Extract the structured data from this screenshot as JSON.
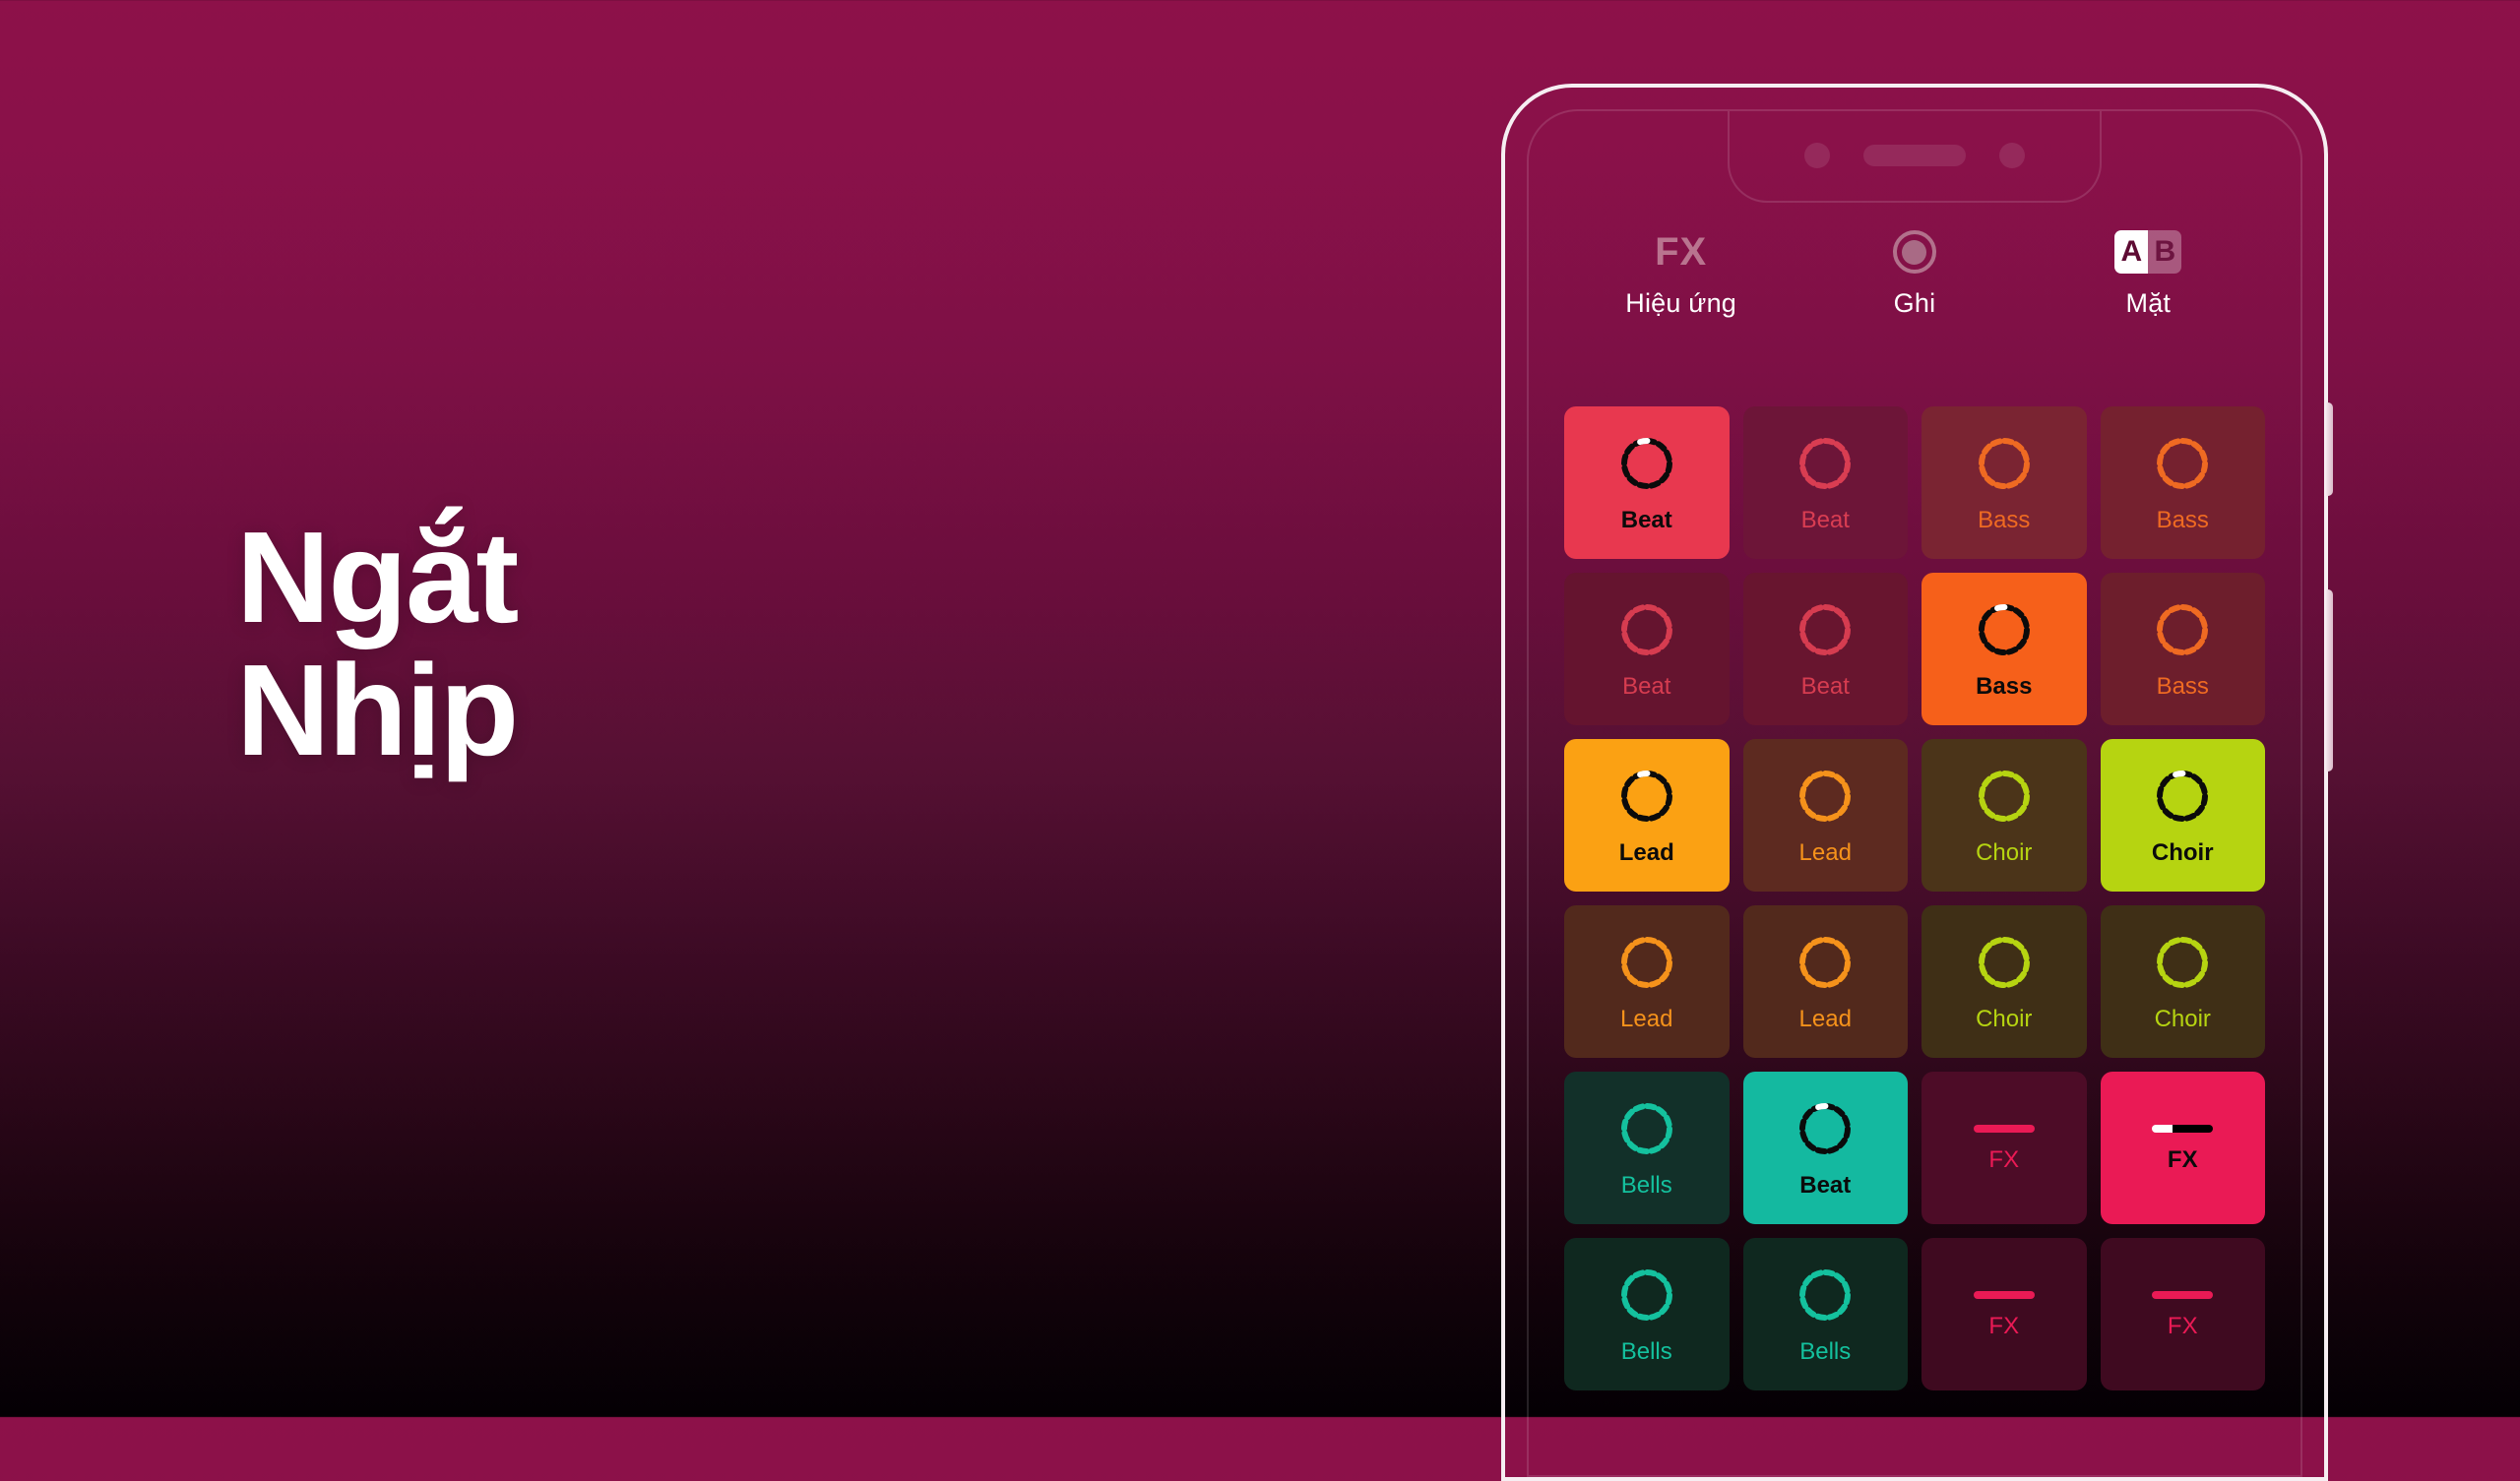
{
  "headline": {
    "line1": "Ngắt",
    "line2": "Nhịp"
  },
  "phone": {
    "notch": {
      "camera_left": "camera-dot",
      "speaker": "speaker-grille",
      "camera_right": "camera-dot"
    },
    "side_buttons": [
      "volume-button",
      "power-button"
    ]
  },
  "toolbar": [
    {
      "id": "fx",
      "glyph": "FX",
      "glyph_type": "text",
      "caption": "Hiệu ứng"
    },
    {
      "id": "record",
      "glyph": "",
      "glyph_type": "rec-ring",
      "caption": "Ghi"
    },
    {
      "id": "ab",
      "glyph": "",
      "glyph_type": "ab-toggle",
      "caption": "Mặt",
      "options": [
        "A",
        "B"
      ],
      "selected": "A"
    }
  ],
  "colors": {
    "bg_top": "#8d1149",
    "bg_bottom": "#040004",
    "beat": "#e8384f",
    "bass": "#f6601a",
    "lead": "#fba113",
    "choir": "#b6d411",
    "bells": "#14c19e",
    "fx": "#ea1a55",
    "active_icon": "#0b0b0b",
    "indicator": "#ffffff"
  },
  "grid": {
    "columns": 4,
    "rows": 6,
    "pads": [
      {
        "label": "Beat",
        "kind": "ring",
        "accent": "beat",
        "active": true,
        "bg": "#e8384f",
        "fg": "#0b0b0b",
        "dark_bg": "#6b1435"
      },
      {
        "label": "Beat",
        "kind": "ring",
        "accent": "beat",
        "active": false,
        "bg": "#6d1538",
        "fg": "#d93d52",
        "dark_bg": "#6d1538"
      },
      {
        "label": "Bass",
        "kind": "ring",
        "accent": "bass",
        "active": false,
        "bg": "#7a2432",
        "fg": "#ef6a22",
        "dark_bg": "#7a2432"
      },
      {
        "label": "Bass",
        "kind": "ring",
        "accent": "bass",
        "active": false,
        "bg": "#75212f",
        "fg": "#ef6a22",
        "dark_bg": "#75212f"
      },
      {
        "label": "Beat",
        "kind": "ring",
        "accent": "beat",
        "active": false,
        "bg": "#65142f",
        "fg": "#d63c50",
        "dark_bg": "#65142f"
      },
      {
        "label": "Beat",
        "kind": "ring",
        "accent": "beat",
        "active": false,
        "bg": "#68152f",
        "fg": "#d63c50",
        "dark_bg": "#68152f"
      },
      {
        "label": "Bass",
        "kind": "ring",
        "accent": "bass",
        "active": true,
        "bg": "#f6601a",
        "fg": "#0b0b0b",
        "dark_bg": "#6f2027"
      },
      {
        "label": "Bass",
        "kind": "ring",
        "accent": "bass",
        "active": false,
        "bg": "#6d1e2c",
        "fg": "#ef6a22",
        "dark_bg": "#6d1e2c"
      },
      {
        "label": "Lead",
        "kind": "ring",
        "accent": "lead",
        "active": true,
        "bg": "#fba113",
        "fg": "#0b0b0b",
        "dark_bg": "#5f2a21"
      },
      {
        "label": "Lead",
        "kind": "ring",
        "accent": "lead",
        "active": false,
        "bg": "#5d2a20",
        "fg": "#f5921b",
        "dark_bg": "#5d2a20"
      },
      {
        "label": "Choir",
        "kind": "ring",
        "accent": "choir",
        "active": false,
        "bg": "#4b3419",
        "fg": "#b6d411",
        "dark_bg": "#4b3419"
      },
      {
        "label": "Choir",
        "kind": "ring",
        "accent": "choir",
        "active": true,
        "bg": "#b6d411",
        "fg": "#0b0b0b",
        "dark_bg": "#4b3419"
      },
      {
        "label": "Lead",
        "kind": "ring",
        "accent": "lead",
        "active": false,
        "bg": "#52291c",
        "fg": "#f5921b",
        "dark_bg": "#52291c"
      },
      {
        "label": "Lead",
        "kind": "ring",
        "accent": "lead",
        "active": false,
        "bg": "#52291c",
        "fg": "#f5921b",
        "dark_bg": "#52291c"
      },
      {
        "label": "Choir",
        "kind": "ring",
        "accent": "choir",
        "active": false,
        "bg": "#3f2f16",
        "fg": "#b6d411",
        "dark_bg": "#3f2f16"
      },
      {
        "label": "Choir",
        "kind": "ring",
        "accent": "choir",
        "active": false,
        "bg": "#3f2f16",
        "fg": "#b6d411",
        "dark_bg": "#3f2f16"
      },
      {
        "label": "Bells",
        "kind": "ring",
        "accent": "bells",
        "active": false,
        "bg": "#123029",
        "fg": "#14c19e",
        "dark_bg": "#123029"
      },
      {
        "label": "Beat",
        "kind": "ring",
        "accent": "bells",
        "active": true,
        "bg": "#14b9a0",
        "fg": "#0b0b0b",
        "dark_bg": "#123029"
      },
      {
        "label": "FX",
        "kind": "bar",
        "accent": "fx",
        "active": false,
        "bg": "#4d0c27",
        "fg": "#ea1a55",
        "dark_bg": "#4d0c27"
      },
      {
        "label": "FX",
        "kind": "bar",
        "accent": "fx",
        "active": true,
        "bg": "#ea1a55",
        "fg": "#0b0b0b",
        "dark_bg": "#4d0c27"
      },
      {
        "label": "Bells",
        "kind": "ring",
        "accent": "bells",
        "active": false,
        "bg": "#0f281f",
        "fg": "#14c19e",
        "dark_bg": "#0f281f"
      },
      {
        "label": "Bells",
        "kind": "ring",
        "accent": "bells",
        "active": false,
        "bg": "#0f281f",
        "fg": "#14c19e",
        "dark_bg": "#0f281f"
      },
      {
        "label": "FX",
        "kind": "bar",
        "accent": "fx",
        "active": false,
        "bg": "#3f0a20",
        "fg": "#ea1a55",
        "dark_bg": "#3f0a20"
      },
      {
        "label": "FX",
        "kind": "bar",
        "accent": "fx",
        "active": false,
        "bg": "#3f0a20",
        "fg": "#ea1a55",
        "dark_bg": "#3f0a20"
      }
    ]
  }
}
